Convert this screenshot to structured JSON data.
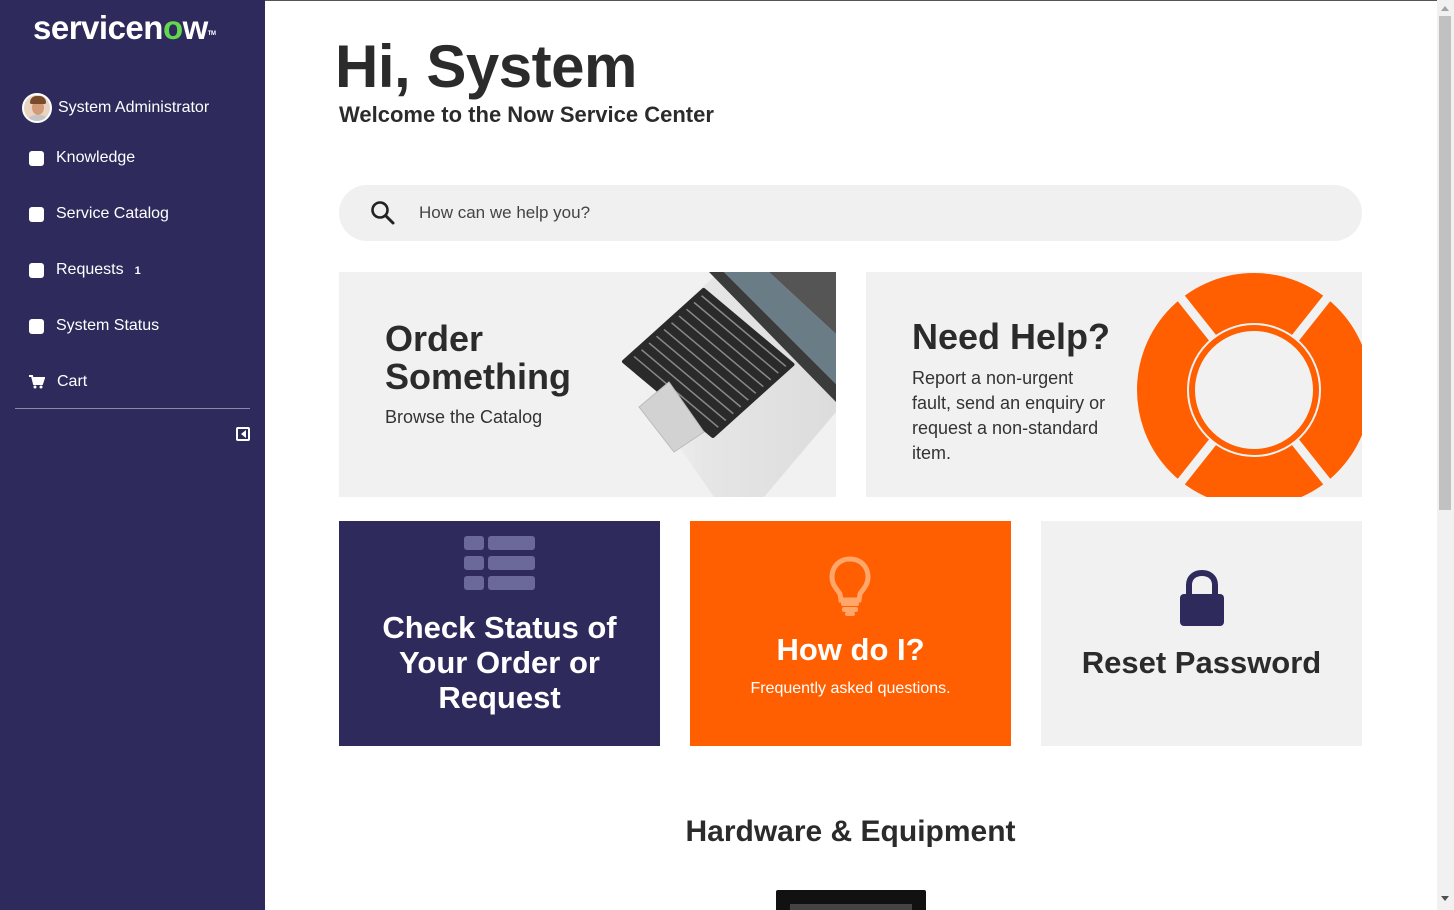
{
  "brand": {
    "logo_text_a": "servicen",
    "logo_text_o": "o",
    "logo_text_b": "w",
    "logo_tm": "TM"
  },
  "user": {
    "name": "System Administrator"
  },
  "nav": {
    "knowledge": "Knowledge",
    "service_catalog": "Service Catalog",
    "requests": "Requests",
    "requests_badge": "1",
    "system_status": "System Status",
    "cart": "Cart"
  },
  "main": {
    "greeting": "Hi, System",
    "welcome": "Welcome to the Now Service Center",
    "search_placeholder": "How can we help you?"
  },
  "cards": {
    "order": {
      "title_line1": "Order",
      "title_line2": "Something",
      "subtitle": "Browse the Catalog"
    },
    "help": {
      "title": "Need Help?",
      "line1": "Report a non-urgent",
      "line2": "fault, send an enquiry or",
      "line3": "request a non-standard",
      "line4": "item."
    },
    "status": {
      "line1": "Check Status of",
      "line2": "Your Order or",
      "line3": "Request"
    },
    "howdo": {
      "title": "How do I?",
      "subtitle": "Frequently asked questions."
    },
    "reset": {
      "title": "Reset Password"
    }
  },
  "sections": {
    "hardware": "Hardware & Equipment"
  },
  "colors": {
    "sidebar": "#2e2a5c",
    "accent_orange": "#ff5f00",
    "logo_green": "#62d84e",
    "card_bg": "#f1f1f1"
  },
  "icons": {
    "search": "search-icon",
    "cart": "cart-icon",
    "list": "list-icon",
    "bulb": "lightbulb-icon",
    "lock": "lock-icon",
    "lifebuoy": "lifebuoy-icon",
    "laptop": "laptop-image"
  }
}
